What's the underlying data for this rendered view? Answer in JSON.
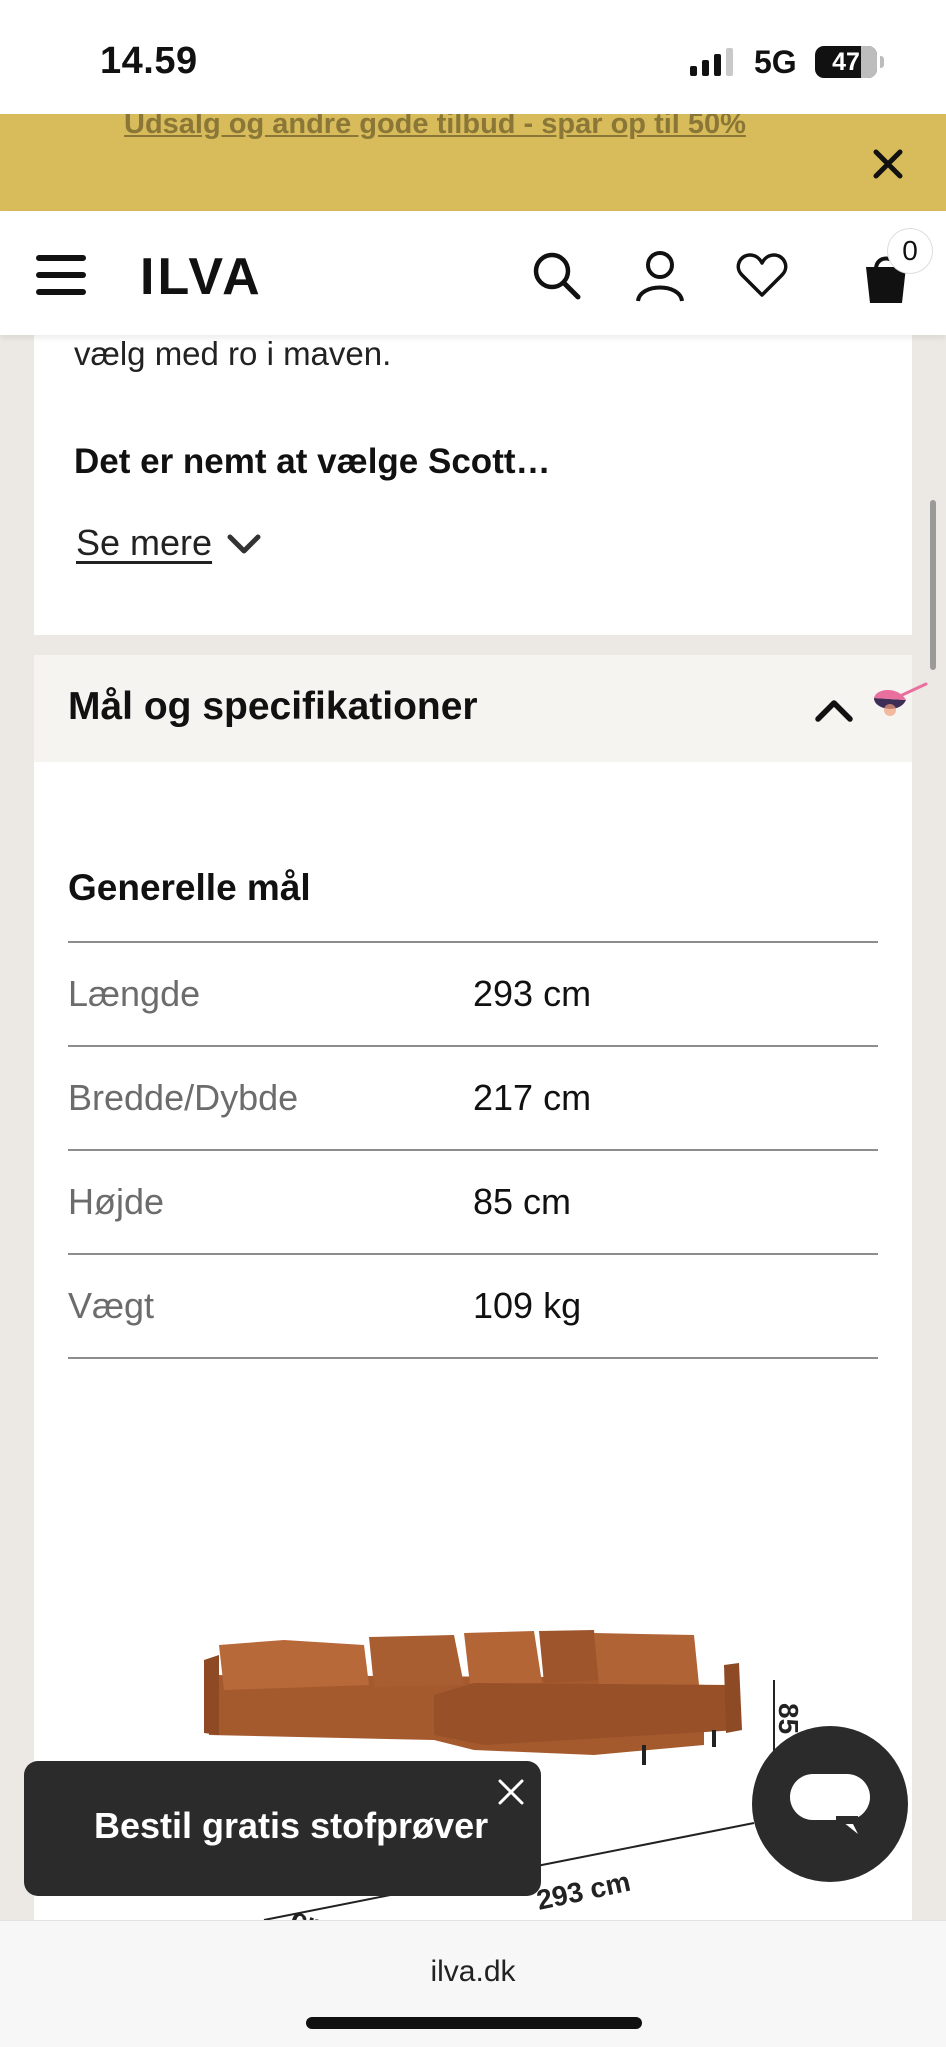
{
  "status_bar": {
    "time": "14.59",
    "network": "5G",
    "battery": "47"
  },
  "promo": {
    "text": "Udsalg og andre gode tilbud - spar op til 50%",
    "bg_color": "#d8bb5a"
  },
  "header": {
    "logo": "ILVA",
    "cart_count": "0",
    "icons": [
      "menu-icon",
      "search-icon",
      "account-icon",
      "heart-icon",
      "bag-icon"
    ]
  },
  "description": {
    "text_tail": "vælg med ro i maven.",
    "bold_line": "Det er nemt at vælge Scott…",
    "see_more": "Se mere"
  },
  "specs": {
    "section_title": "Mål og specifikationer",
    "group_title": "Generelle mål",
    "rows": [
      {
        "label": "Længde",
        "value": "293 cm"
      },
      {
        "label": "Bredde/Dybde",
        "value": "217 cm"
      },
      {
        "label": "Højde",
        "value": "85 cm"
      },
      {
        "label": "Vægt",
        "value": "109 kg"
      }
    ]
  },
  "illustration": {
    "dim_length": "293 cm",
    "dim_height": "85 cm",
    "dim_depth": "cm",
    "sofa_color": "#a55a2e"
  },
  "toast": {
    "text": "Bestil gratis stofprøver"
  },
  "browser": {
    "url": "ilva.dk"
  }
}
